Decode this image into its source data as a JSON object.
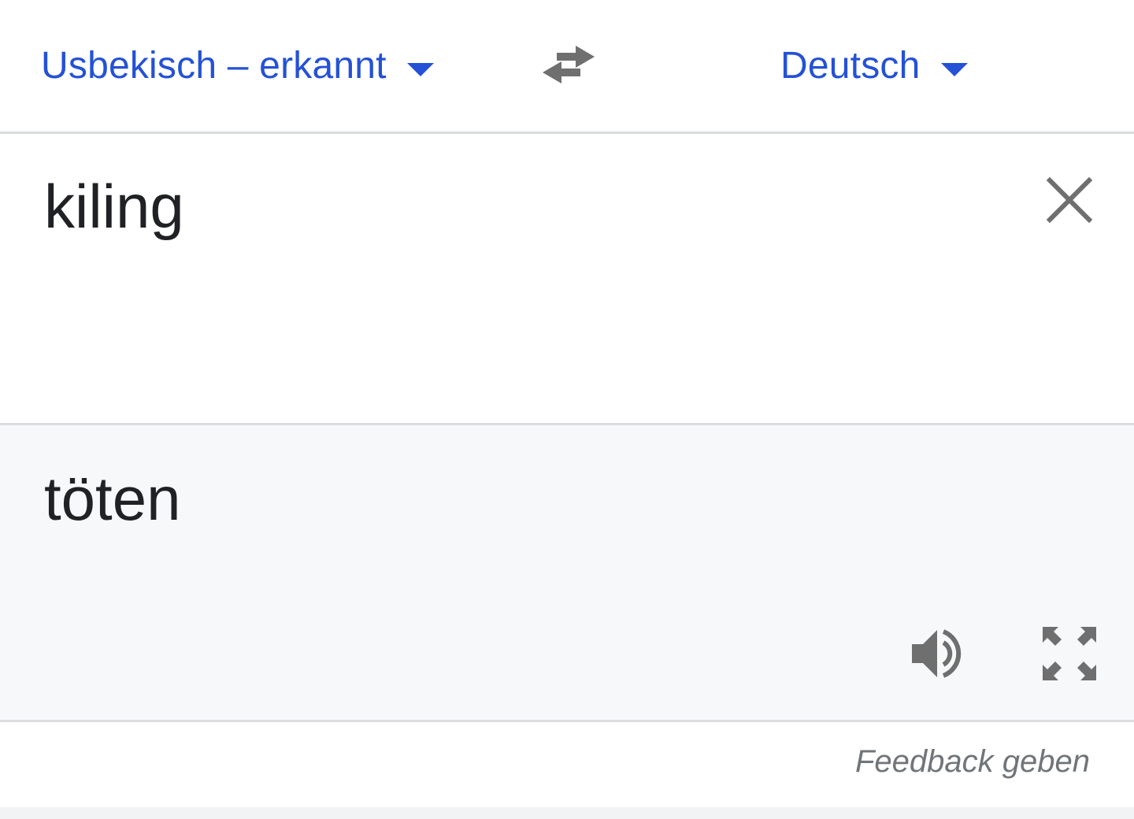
{
  "language_bar": {
    "source_language": "Usbekisch – erkannt",
    "target_language": "Deutsch",
    "swap_icon": "swap-arrows-icon"
  },
  "source": {
    "text": "kiling",
    "clear_icon": "close-icon"
  },
  "translation": {
    "text": "töten",
    "speak_icon": "volume-icon",
    "fullscreen_icon": "fullscreen-icon"
  },
  "footer": {
    "feedback_label": "Feedback geben"
  },
  "colors": {
    "accent": "#2451d6",
    "icon": "#6f6f6f",
    "text": "#202124",
    "muted": "#70757a",
    "translation_bg": "#f7f8fa",
    "divider": "#dadce0"
  }
}
